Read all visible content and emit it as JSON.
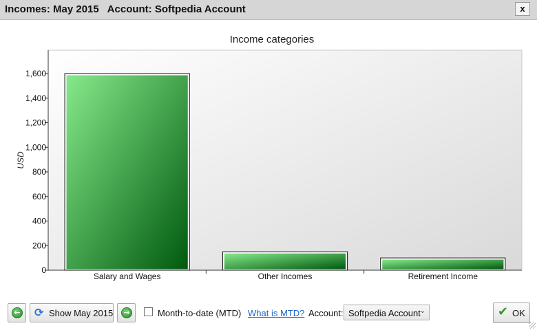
{
  "window": {
    "title": "Incomes: May 2015   Account: Softpedia Account",
    "close_label": "x"
  },
  "chart_data": {
    "type": "bar",
    "title": "Income categories",
    "xlabel": "",
    "ylabel": "USD",
    "categories": [
      "Salary and Wages",
      "Other Incomes",
      "Retirement Income"
    ],
    "values": [
      1600,
      150,
      100
    ],
    "ylim": [
      0,
      1800
    ],
    "y_ticks": [
      0,
      200,
      400,
      600,
      800,
      1000,
      1200,
      1400,
      1600
    ],
    "y_tick_labels": [
      "0",
      "200",
      "400",
      "600",
      "800",
      "1,000",
      "1,200",
      "1,400",
      "1,600"
    ],
    "grid": false,
    "legend": "none",
    "bar_color_light": "#86e98a",
    "bar_color_dark": "#005a0f"
  },
  "toolbar": {
    "prev_icon": "arrow-left-icon",
    "refresh_icon": "refresh-icon",
    "show_label": "Show May 2015",
    "next_icon": "arrow-right-icon",
    "mtd_label": "Month-to-date (MTD)",
    "mtd_checked": false,
    "mtd_link": "What is MTD?",
    "account_label": "Account:",
    "account_value": "Softpedia Account",
    "ok_icon": "checkmark-icon",
    "ok_label": "OK"
  }
}
